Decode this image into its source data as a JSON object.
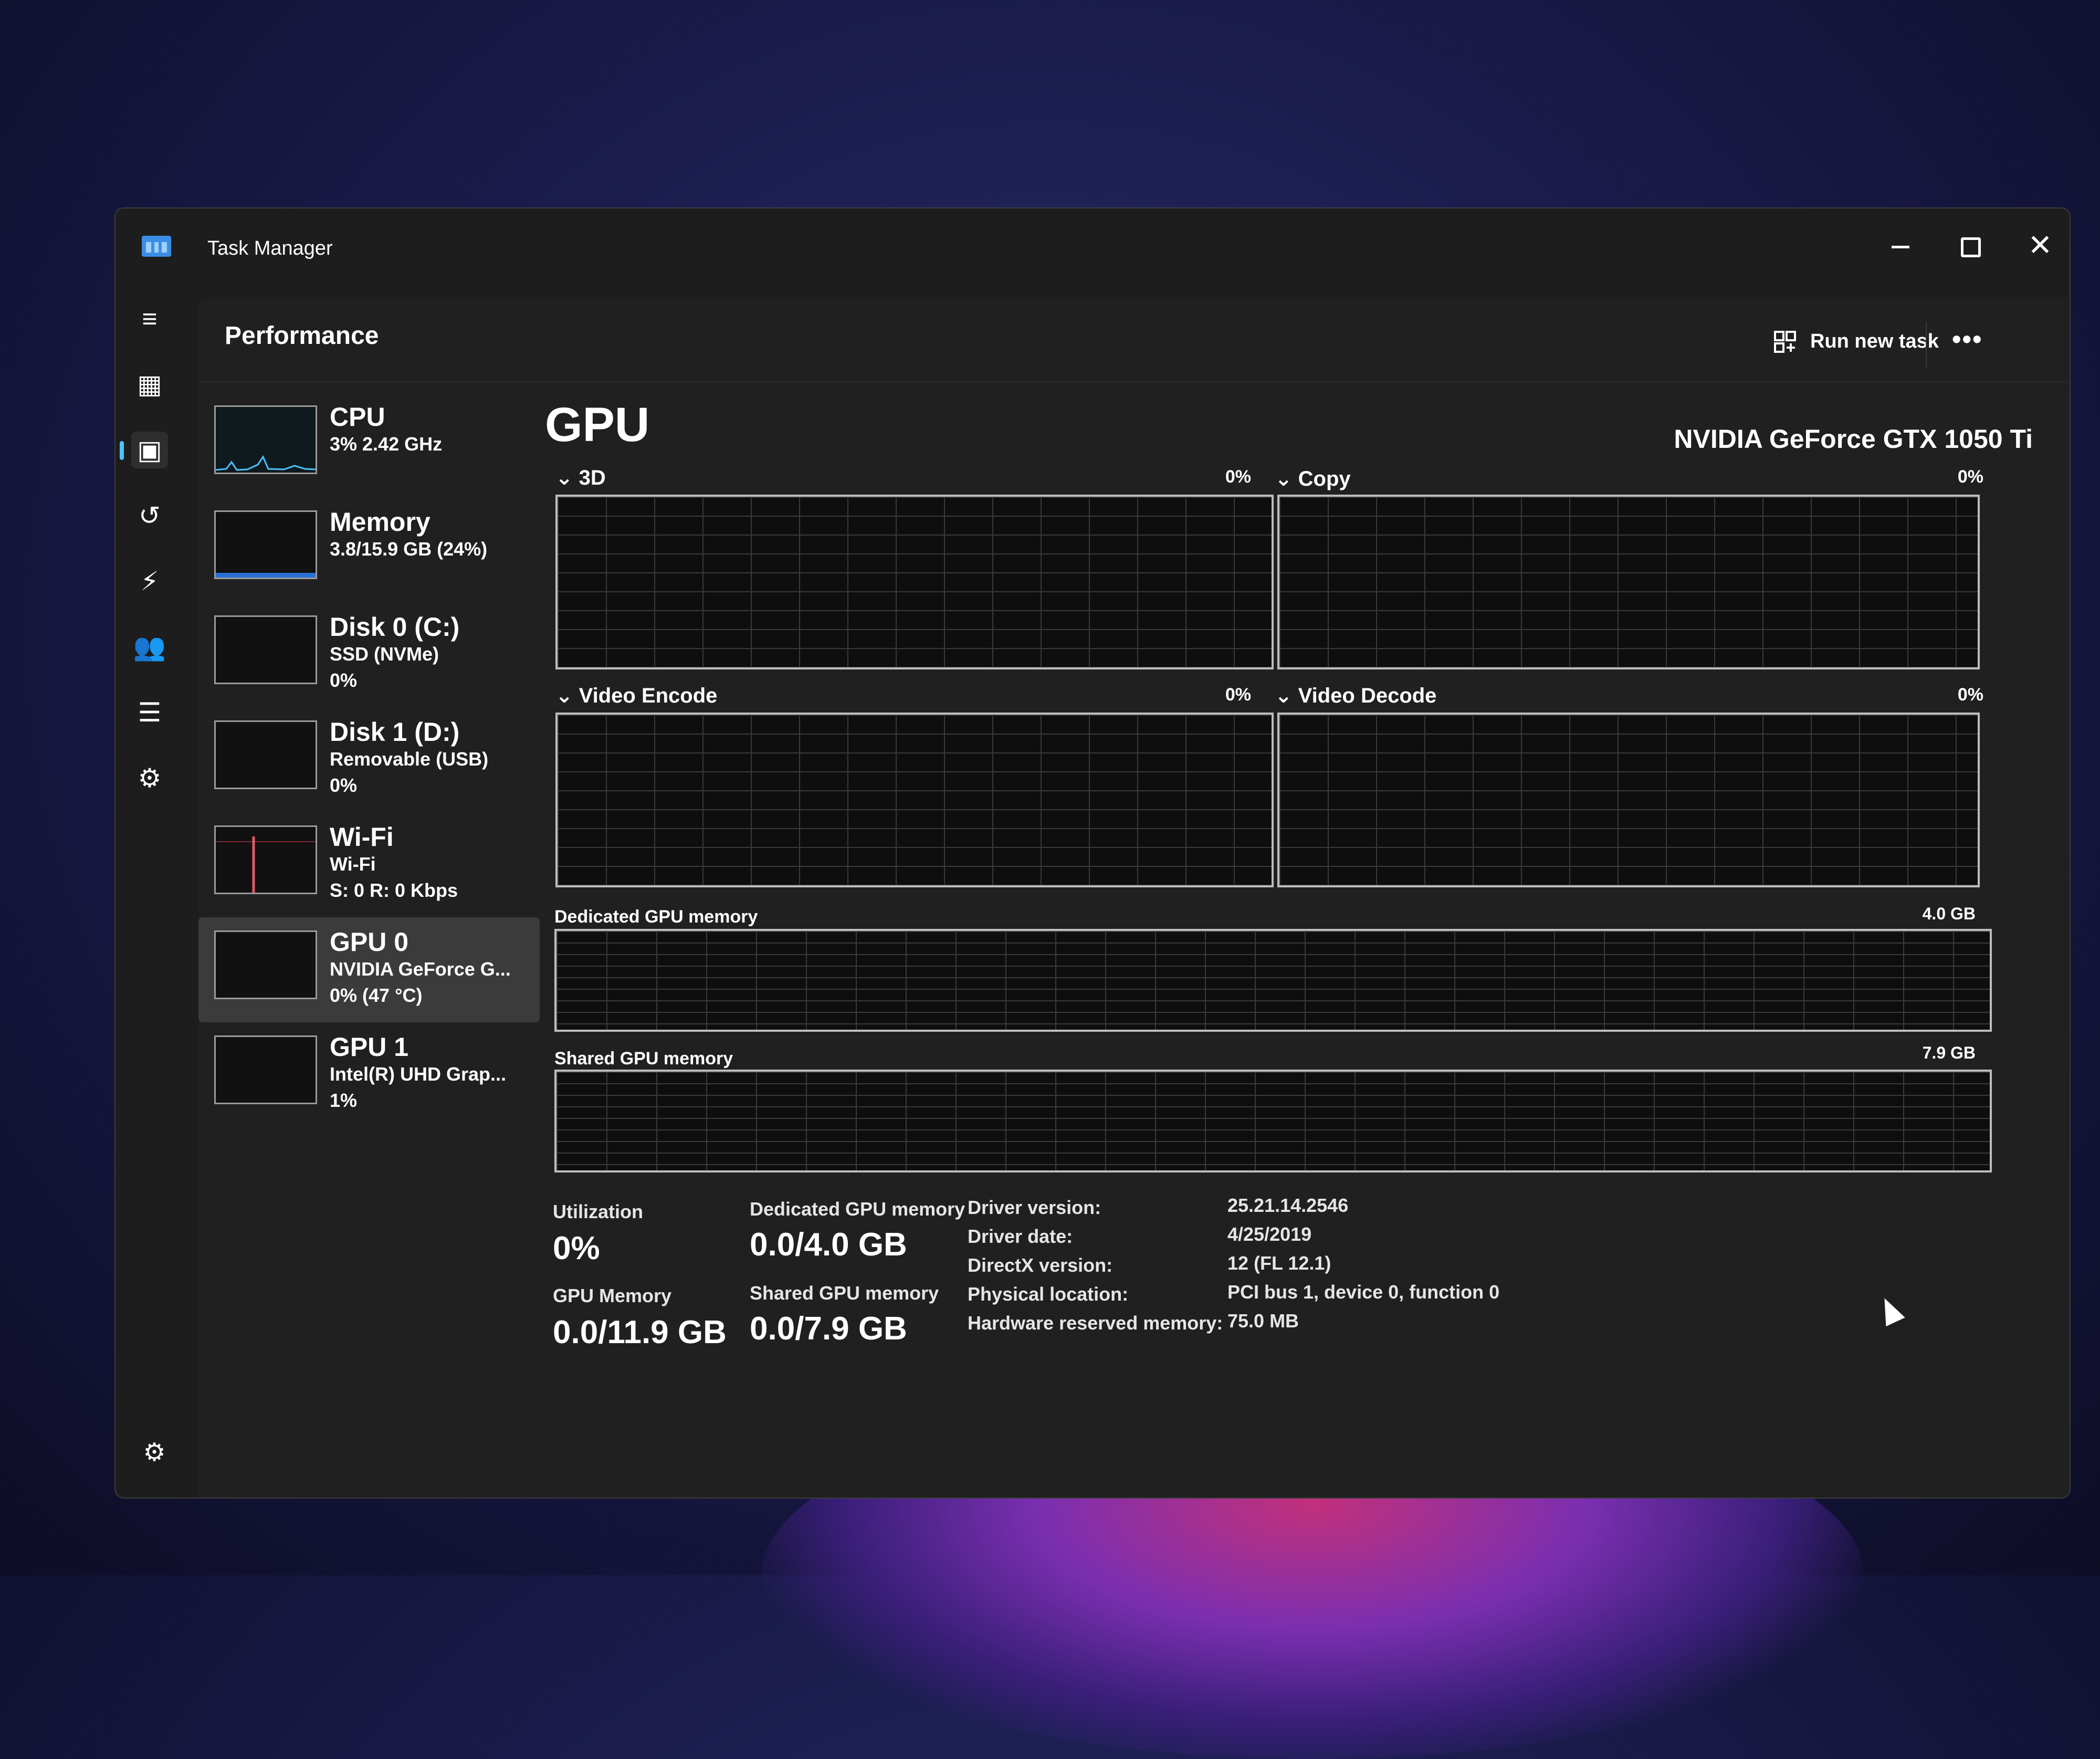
{
  "window": {
    "title": "Task Manager",
    "minimize_icon": "minimize-icon",
    "maximize_icon": "maximize-icon",
    "close_icon": "close-icon"
  },
  "nav": {
    "items": [
      {
        "icon": "hamburger-menu-icon",
        "glyph": "≡"
      },
      {
        "icon": "processes-icon",
        "glyph": "▦"
      },
      {
        "icon": "performance-icon",
        "glyph": "▣",
        "active": true
      },
      {
        "icon": "app-history-icon",
        "glyph": "↺"
      },
      {
        "icon": "startup-apps-icon",
        "glyph": "⚡"
      },
      {
        "icon": "users-icon",
        "glyph": "👥"
      },
      {
        "icon": "details-icon",
        "glyph": "☰"
      },
      {
        "icon": "services-icon",
        "glyph": "⚙"
      }
    ],
    "settings_icon": "settings-gear-icon"
  },
  "header": {
    "page_title": "Performance",
    "run_new_task": "Run new task",
    "more": "•••"
  },
  "resources": [
    {
      "name": "CPU",
      "line2": "3% 2.42 GHz",
      "line3": ""
    },
    {
      "name": "Memory",
      "line2": "3.8/15.9 GB (24%)",
      "line3": ""
    },
    {
      "name": "Disk 0 (C:)",
      "line2": "SSD (NVMe)",
      "line3": "0%"
    },
    {
      "name": "Disk 1 (D:)",
      "line2": "Removable (USB)",
      "line3": "0%"
    },
    {
      "name": "Wi-Fi",
      "line2": "Wi-Fi",
      "line3": "S: 0 R: 0 Kbps"
    },
    {
      "name": "GPU 0",
      "line2": "NVIDIA GeForce G...",
      "line3": "0% (47 °C)",
      "selected": true
    },
    {
      "name": "GPU 1",
      "line2": "Intel(R) UHD Grap...",
      "line3": "1%"
    }
  ],
  "resource_thumbs": {
    "cpu_usage_percent": 3,
    "memory_usage_percent": 24
  },
  "gpu": {
    "title": "GPU",
    "model": "NVIDIA GeForce GTX 1050 Ti",
    "engines": [
      {
        "label": "3D",
        "percent": "0%"
      },
      {
        "label": "Copy",
        "percent": "0%"
      },
      {
        "label": "Video Encode",
        "percent": "0%"
      },
      {
        "label": "Video Decode",
        "percent": "0%"
      }
    ],
    "dedicated_memory_label": "Dedicated GPU memory",
    "dedicated_memory_max": "4.0 GB",
    "shared_memory_label": "Shared GPU memory",
    "shared_memory_max": "7.9 GB"
  },
  "stats": {
    "utilization_label": "Utilization",
    "utilization_value": "0%",
    "gpu_memory_label": "GPU Memory",
    "gpu_memory_value": "0.0/11.9 GB",
    "dedicated_label": "Dedicated GPU memory",
    "dedicated_value": "0.0/4.0 GB",
    "shared_label": "Shared GPU memory",
    "shared_value": "0.0/7.9 GB"
  },
  "info": [
    {
      "key": "Driver version:",
      "value": "25.21.14.2546"
    },
    {
      "key": "Driver date:",
      "value": "4/25/2019"
    },
    {
      "key": "DirectX version:",
      "value": "12 (FL 12.1)"
    },
    {
      "key": "Physical location:",
      "value": "PCI bus 1, device 0, function 0"
    },
    {
      "key": "Hardware reserved memory:",
      "value": "75.0 MB"
    }
  ],
  "colors": {
    "accent": "#4cc2ff",
    "memory_fill": "#2a6fd6",
    "wifi_spike": "#e05a6a"
  }
}
